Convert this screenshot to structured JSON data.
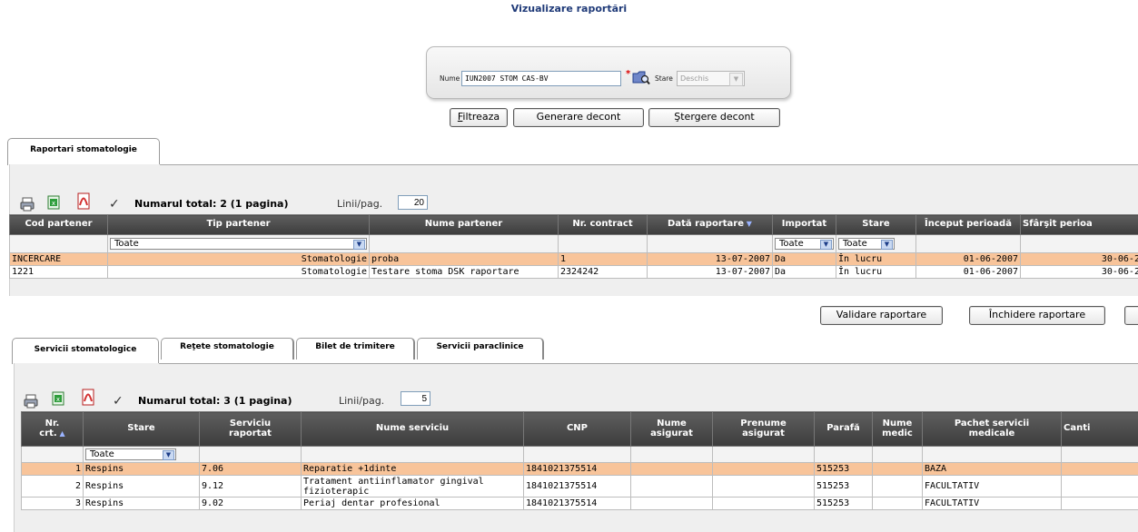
{
  "page": {
    "title": "Vizualizare raportări"
  },
  "filter": {
    "name_label": "Nume",
    "name_value": "IUN2007 STOM CAS-BV",
    "required_mark": "*",
    "state_label": "Stare",
    "state_value": "Deschis",
    "buttons": {
      "filter_accel": "F",
      "filter_rest": "iltreaza",
      "generate": "Generare decont",
      "delete": "Ştergere decont"
    }
  },
  "panel1": {
    "tab_label": "Raportari stomatologie",
    "total_text": "Numarul total: 2 (1 pagina)",
    "lines_label": "Linii/pag.",
    "lines_value": "20",
    "columns": [
      "Cod partener",
      "Tip partener",
      "Nume partener",
      "Nr. contract",
      "Dată raportare",
      "Importat",
      "Stare",
      "Început perioadă",
      "Sfârşit perioa"
    ],
    "filters": {
      "tip_partener": "Toate",
      "importat": "Toate",
      "stare": "Toate"
    },
    "rows": [
      {
        "cod": "INCERCARE",
        "tip": "Stomatologie",
        "nume": "proba",
        "contract": "1",
        "data": "13-07-2007",
        "importat": "Da",
        "stare": "În lucru",
        "inceput": "01-06-2007",
        "sfarsit": "30-06-20"
      },
      {
        "cod": "1221",
        "tip": "Stomatologie",
        "nume": "Testare stoma DSK raportare",
        "contract": "2324242",
        "data": "13-07-2007",
        "importat": "Da",
        "stare": "În lucru",
        "inceput": "01-06-2007",
        "sfarsit": "30-06-20"
      }
    ],
    "actions": {
      "validate": "Validare raportare",
      "close": "Închidere raportare"
    }
  },
  "panel2": {
    "tabs": [
      "Servicii stomatologice",
      "Reţete stomatologie",
      "Bilet de trimitere",
      "Servicii paraclinice"
    ],
    "total_text": "Numarul total: 3 (1 pagina)",
    "lines_label": "Linii/pag.",
    "lines_value": "5",
    "columns": {
      "nr_1": "Nr.",
      "nr_2": "crt.",
      "stare": "Stare",
      "serviciu_1": "Serviciu",
      "serviciu_2": "raportat",
      "nume_serviciu": "Nume serviciu",
      "cnp": "CNP",
      "nume_asig_1": "Nume",
      "nume_asig_2": "asigurat",
      "prenume_1": "Prenume",
      "prenume_2": "asigurat",
      "parafa": "Parafă",
      "medic_1": "Nume",
      "medic_2": "medic",
      "pachet_1": "Pachet servicii",
      "pachet_2": "medicale",
      "cant": "Canti"
    },
    "filters": {
      "stare": "Toate"
    },
    "rows": [
      {
        "nr": "1",
        "stare": "Respins",
        "serviciu": "7.06",
        "nume": "Reparatie +1dinte",
        "cnp": "1841021375514",
        "parafa": "515253",
        "pachet": "BAZA"
      },
      {
        "nr": "2",
        "stare": "Respins",
        "serviciu": "9.12",
        "nume": "Tratament antiinflamator gingival fizioterapic",
        "cnp": "1841021375514",
        "parafa": "515253",
        "pachet": "FACULTATIV"
      },
      {
        "nr": "3",
        "stare": "Respins",
        "serviciu": "9.02",
        "nume": "Periaj dentar profesional",
        "cnp": "1841021375514",
        "parafa": "515253",
        "pachet": "FACULTATIV"
      }
    ]
  }
}
